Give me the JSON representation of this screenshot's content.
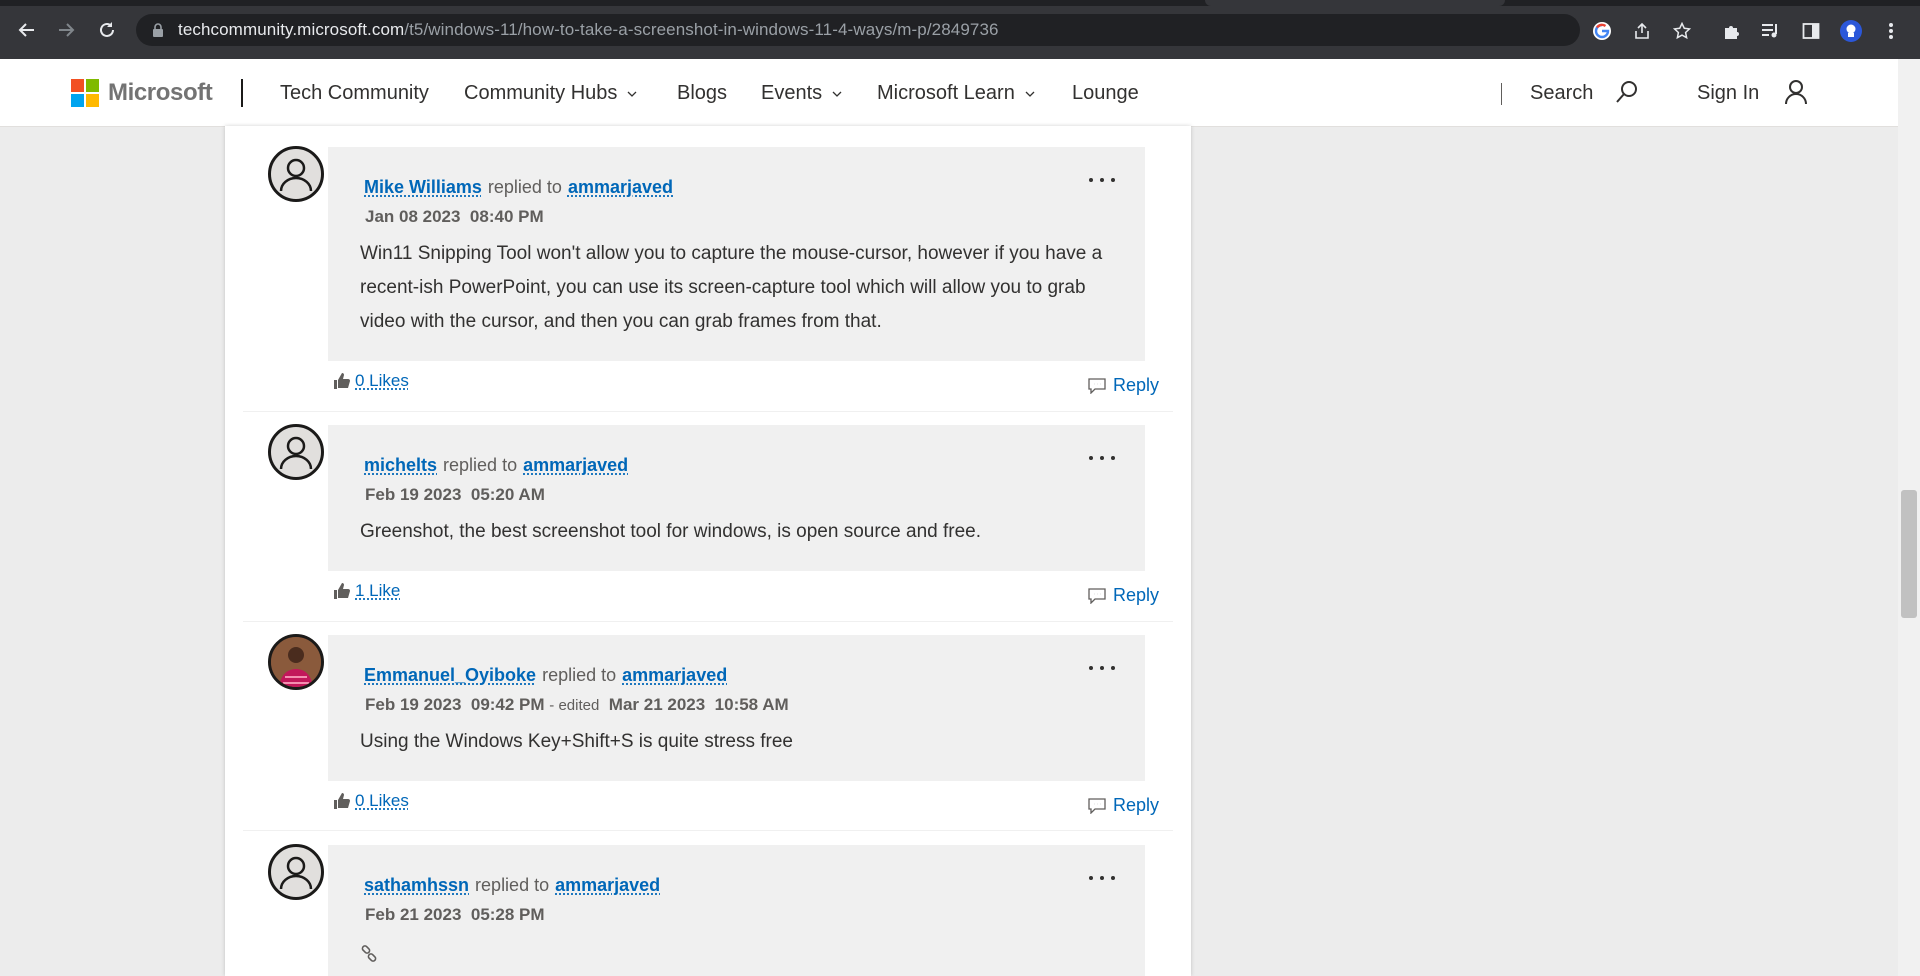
{
  "browser": {
    "url_host": "techcommunity.microsoft.com",
    "url_path": "/t5/windows-11/how-to-take-a-screenshot-in-windows-11-4-ways/m-p/2849736"
  },
  "header": {
    "brand": "Microsoft",
    "site_name": "Tech Community",
    "nav": [
      {
        "label": "Community Hubs",
        "has_dropdown": true
      },
      {
        "label": "Blogs",
        "has_dropdown": false
      },
      {
        "label": "Events",
        "has_dropdown": true
      },
      {
        "label": "Microsoft Learn",
        "has_dropdown": true
      },
      {
        "label": "Lounge",
        "has_dropdown": false
      }
    ],
    "search_label": "Search",
    "signin_label": "Sign In",
    "logo_colors": [
      "#f25022",
      "#7fba00",
      "#00a4ef",
      "#ffb900"
    ]
  },
  "replies": [
    {
      "author": "Mike Williams",
      "replied_to_text": "replied to",
      "target": "ammarjaved",
      "date": "Jan 08 2023",
      "time": "08:40 PM",
      "body": "Win11 Snipping Tool won't allow you to capture the mouse-cursor, however if you have a recent-ish PowerPoint, you can use its screen-capture tool which will allow you to grab video with the cursor, and then you can grab frames from that.",
      "likes": "0 Likes",
      "reply_label": "Reply"
    },
    {
      "author": "michelts",
      "replied_to_text": "replied to",
      "target": "ammarjaved",
      "date": "Feb 19 2023",
      "time": "05:20 AM",
      "body": "Greenshot, the best screenshot tool for windows, is open source and free.",
      "likes": "1 Like",
      "reply_label": "Reply"
    },
    {
      "author": "Emmanuel_Oyiboke",
      "replied_to_text": "replied to",
      "target": "ammarjaved",
      "date": "Feb 19 2023",
      "time": "09:42 PM",
      "edited_label": "- edited",
      "edited_date": "Mar 21 2023",
      "edited_time": "10:58 AM",
      "body": "Using the Windows Key+Shift+S is quite stress free",
      "likes": "0 Likes",
      "reply_label": "Reply"
    },
    {
      "author": "sathamhssn",
      "replied_to_text": "replied to",
      "target": "ammarjaved",
      "date": "Feb 21 2023",
      "time": "05:28 PM"
    }
  ]
}
